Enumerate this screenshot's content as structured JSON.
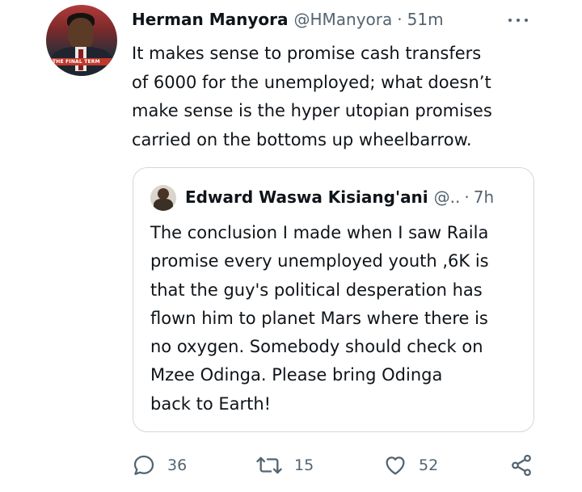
{
  "tweet": {
    "author_name": "Herman Manyora",
    "handle": "@HManyora",
    "separator": "·",
    "time": "51m",
    "avatar_banner": "THE FINAL TERM",
    "text_lines": [
      "It makes sense to promise cash transfers",
      "of 6000 for the unemployed; what doesn’t",
      "make sense is the hyper utopian promises",
      "carried on the bottoms up wheelbarrow."
    ]
  },
  "quote": {
    "author_name": "Edward Waswa Kisiang'ani",
    "handle": "@..",
    "separator": "·",
    "time": "7h",
    "text_lines": [
      "The conclusion I made when I saw Raila",
      "promise every unemployed youth ,6K is",
      "that the guy's  political desperation has",
      "flown him to planet Mars where there is",
      "no oxygen. Somebody should check on",
      "Mzee Odinga. Please bring  Odinga",
      "back to Earth!"
    ]
  },
  "actions": {
    "replies": "36",
    "retweets": "15",
    "likes": "52"
  },
  "icons": {
    "reply": "reply-icon",
    "retweet": "retweet-icon",
    "like": "heart-icon",
    "share": "share-icon",
    "more": "more-options-icon"
  },
  "colors": {
    "text": "#0f1419",
    "secondary": "#536471",
    "border": "#cfd9de"
  }
}
